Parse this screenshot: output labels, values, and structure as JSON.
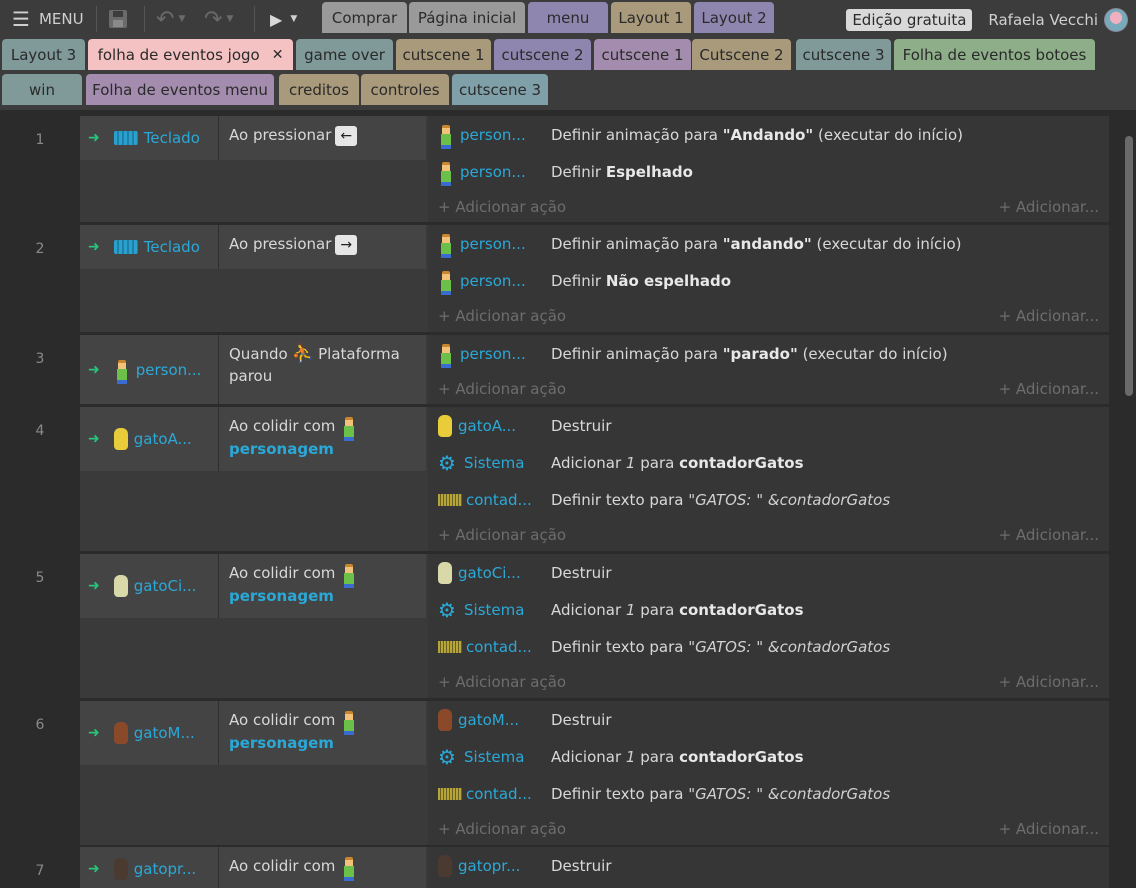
{
  "toolbar": {
    "menu_label": "MENU",
    "menu_icon": "hamburger-icon",
    "save_icon": "save-icon",
    "undo_icon": "undo-icon",
    "redo_icon": "redo-icon",
    "play_icon": "play-icon"
  },
  "top_tabs": [
    {
      "label": "Comprar",
      "color": "#9a9a9a"
    },
    {
      "label": "Página inicial",
      "color": "#9a9a9a"
    },
    {
      "label": "menu",
      "color": "#8f86b0"
    },
    {
      "label": "Layout 1",
      "color": "#a89a7a"
    },
    {
      "label": "Layout 2",
      "color": "#8f86b0"
    }
  ],
  "user": {
    "badge": "Edição gratuita",
    "name": "Rafaela Vecchi"
  },
  "tabs_row1": [
    {
      "label": "Layout 3",
      "color": "#7f9a99"
    },
    {
      "label": "folha de eventos jogo",
      "color": "#f4c2c2",
      "close": "✕",
      "active": true
    },
    {
      "label": "game over",
      "color": "#7f9a99"
    },
    {
      "label": "cutscene 1",
      "color": "#a89a7a"
    },
    {
      "label": "cutscene 2",
      "color": "#8f86b0"
    },
    {
      "label": "cutscene 1",
      "color": "#a38cae"
    },
    {
      "label": "Cutscene 2",
      "color": "#a89a7a"
    },
    {
      "label": "cutscene 3",
      "color": "#7f9a99"
    },
    {
      "label": "Folha de eventos botoes",
      "color": "#8eae8a"
    }
  ],
  "tabs_row2": [
    {
      "label": "win",
      "color": "#7f9a99"
    },
    {
      "label": "Folha de eventos menu",
      "color": "#a38cae"
    },
    {
      "label": "creditos",
      "color": "#a89a7a"
    },
    {
      "label": "controles",
      "color": "#a89a7a"
    },
    {
      "label": "cutscene 3",
      "color": "#7fa0a8"
    }
  ],
  "add_action": "Adicionar ação",
  "add_more": "Adicionar...",
  "events": [
    {
      "num": "1",
      "cond_obj": "Teclado",
      "cond_pre": "Ao pressionar",
      "key": "←",
      "actions": [
        {
          "obj": "person...",
          "pre": "Definir animação para ",
          "bold": "\"Andando\"",
          "post": " (executar do início)"
        },
        {
          "obj": "person...",
          "pre": "Definir ",
          "bold": "Espelhado",
          "post": ""
        }
      ]
    },
    {
      "num": "2",
      "cond_obj": "Teclado",
      "cond_pre": "Ao pressionar",
      "key": "→",
      "actions": [
        {
          "obj": "person...",
          "pre": "Definir animação para ",
          "bold": "\"andando\"",
          "post": " (executar do início)"
        },
        {
          "obj": "person...",
          "pre": "Definir ",
          "bold": "Não espelhado",
          "post": ""
        }
      ]
    },
    {
      "num": "3",
      "cond_obj": "person...",
      "cond_pre": "Quando",
      "cond_mid": "Plataforma",
      "cond_post": "parou",
      "actions": [
        {
          "obj": "person...",
          "pre": "Definir animação para ",
          "bold": "\"parado\"",
          "post": " (executar do início)"
        }
      ]
    },
    {
      "num": "4",
      "cond_obj": "gatoA...",
      "cond_pre": "Ao colidir com",
      "cond_target": "personagem",
      "actions": [
        {
          "obj": "gatoA...",
          "pre": "Destruir",
          "bold": "",
          "post": ""
        },
        {
          "obj": "Sistema",
          "pre": "Adicionar ",
          "ital": "1",
          "pre2": " para ",
          "bold": "contadorGatos",
          "post": ""
        },
        {
          "obj": "contad...",
          "pre": "Definir texto para ",
          "ital": "\"GATOS: \" &contadorGatos",
          "bold": "",
          "post": ""
        }
      ]
    },
    {
      "num": "5",
      "cond_obj": "gatoCi...",
      "cond_pre": "Ao colidir com",
      "cond_target": "personagem",
      "actions": [
        {
          "obj": "gatoCi...",
          "pre": "Destruir",
          "bold": "",
          "post": ""
        },
        {
          "obj": "Sistema",
          "pre": "Adicionar ",
          "ital": "1",
          "pre2": " para ",
          "bold": "contadorGatos",
          "post": ""
        },
        {
          "obj": "contad...",
          "pre": "Definir texto para ",
          "ital": "\"GATOS: \" &contadorGatos",
          "bold": "",
          "post": ""
        }
      ]
    },
    {
      "num": "6",
      "cond_obj": "gatoM...",
      "cond_pre": "Ao colidir com",
      "cond_target": "personagem",
      "actions": [
        {
          "obj": "gatoM...",
          "pre": "Destruir",
          "bold": "",
          "post": ""
        },
        {
          "obj": "Sistema",
          "pre": "Adicionar ",
          "ital": "1",
          "pre2": " para ",
          "bold": "contadorGatos",
          "post": ""
        },
        {
          "obj": "contad...",
          "pre": "Definir texto para ",
          "ital": "\"GATOS: \" &contadorGatos",
          "bold": "",
          "post": ""
        }
      ]
    },
    {
      "num": "7",
      "cond_obj": "gatopr...",
      "cond_pre": "Ao colidir com",
      "cond_target": "",
      "actions": [
        {
          "obj": "gatopr...",
          "pre": "Destruir",
          "bold": "",
          "post": ""
        }
      ]
    }
  ]
}
